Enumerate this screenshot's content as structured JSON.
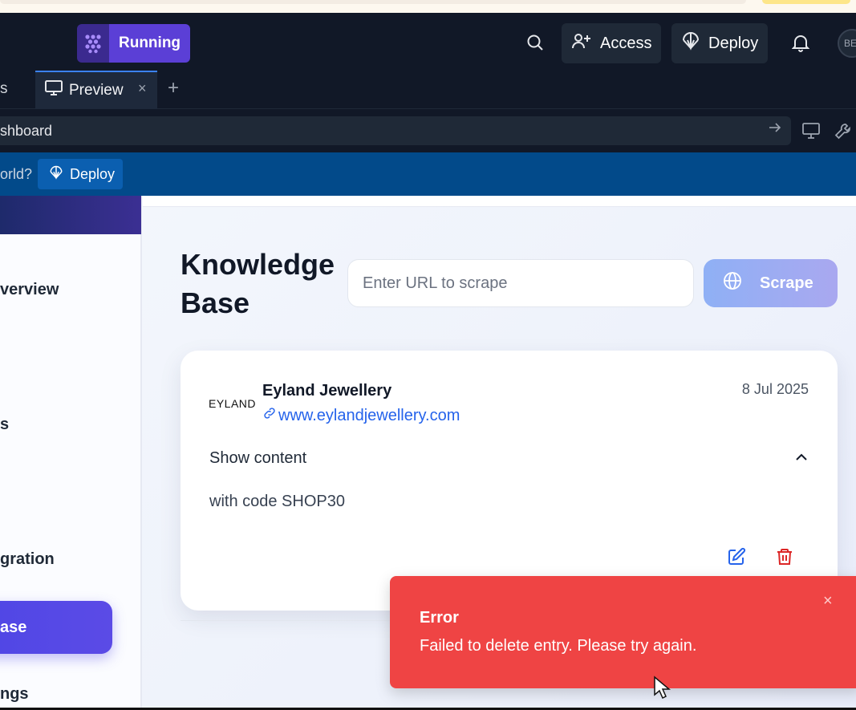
{
  "header": {
    "status_label": "Running",
    "access_label": "Access",
    "deploy_label": "Deploy",
    "avatar_initials": "BE"
  },
  "tabs": {
    "previous_tab_fragment": "s",
    "active_tab_label": "Preview",
    "close_symbol": "×",
    "add_symbol": "+"
  },
  "address_bar": {
    "url_fragment": "shboard"
  },
  "banner": {
    "text_fragment": "orld?",
    "deploy_label": "Deploy"
  },
  "sidebar": {
    "items": [
      {
        "label": "verview"
      },
      {
        "label": "s"
      },
      {
        "label": "gration"
      },
      {
        "label": "ase"
      },
      {
        "label": "ngs"
      }
    ]
  },
  "main": {
    "title_line1": "Knowledge",
    "title_line2": "Base",
    "url_placeholder": "Enter URL to scrape",
    "scrape_label": "Scrape"
  },
  "entries": [
    {
      "logo_text": "EYLAND",
      "name": "Eyland Jewellery",
      "url": "www.eylandjewellery.com",
      "date": "8 Jul 2025",
      "toggle_label": "Show content",
      "content": "with code SHOP30"
    }
  ],
  "toast": {
    "title": "Error",
    "message": "Failed to delete entry. Please try again.",
    "close_symbol": "×"
  },
  "colors": {
    "primary": "#4f46e5",
    "link": "#2563eb",
    "error": "#ef4444",
    "delete_icon": "#dc2626",
    "banner": "#024a8a"
  }
}
